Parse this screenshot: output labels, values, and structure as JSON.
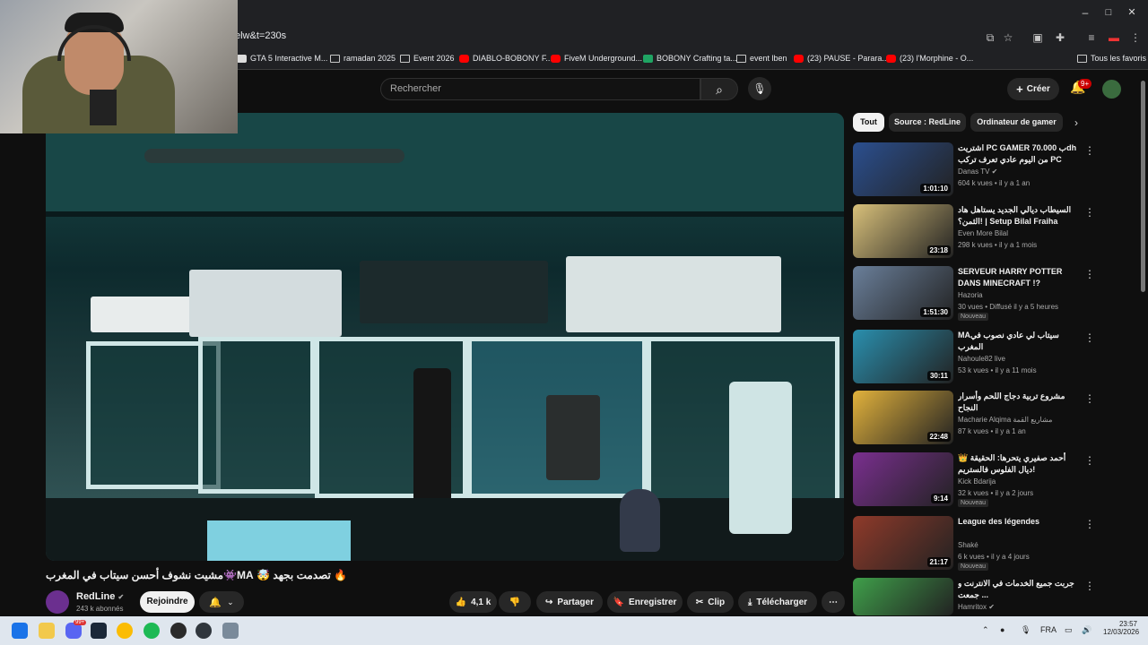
{
  "browser": {
    "address": "elw&t=230s",
    "window_controls": [
      "–",
      "□",
      "✕"
    ],
    "bookmarks": [
      {
        "label": "GTA 5 Interactive M...",
        "icon": "white"
      },
      {
        "label": "ramadan 2025",
        "icon": "folder"
      },
      {
        "label": "Event 2026",
        "icon": "folder"
      },
      {
        "label": "DIABLO-BOBONY F...",
        "icon": "yt"
      },
      {
        "label": "FiveM Underground...",
        "icon": "yt"
      },
      {
        "label": "BOBONY Crafting ta...",
        "icon": "green"
      },
      {
        "label": "event lben",
        "icon": "folder"
      },
      {
        "label": "(23) PAUSE - Parara...",
        "icon": "yt"
      },
      {
        "label": "(23) l'Morphine - O...",
        "icon": "yt"
      }
    ],
    "all_bookmarks": "Tous les favoris"
  },
  "masthead": {
    "search_placeholder": "Rechercher",
    "create_label": "Créer",
    "notif_count": "9+"
  },
  "video": {
    "title": "🔥 تصدمت بجهد 🤯 MA👾مشيت نشوف أحسن سيتاب في المغرب",
    "channel_name": "RedLine",
    "subscribers": "243 k abonnés",
    "join_label": "Rejoindre",
    "likes": "4,1 k",
    "share_label": "Partager",
    "save_label": "Enregistrer",
    "clip_label": "Clip",
    "download_label": "Télécharger"
  },
  "chips": [
    "Tout",
    "Source : RedLine",
    "Ordinateur de gamer"
  ],
  "related": [
    {
      "title": "اشتريت PC GAMER ب 70.000dh من اليوم عادي تعرف تركب PC بوحدك...",
      "channel": "Danas TV",
      "verified": true,
      "meta": "604 k vues • il y a 1 an",
      "duration": "1:01:10",
      "badge": "",
      "thumb_color": "#2b4f8f"
    },
    {
      "title": "السيطاب ديالي الجديد يستاهل هاد الثمن؟! | Setup Bilal Fraiha",
      "channel": "Even More Bilal",
      "verified": false,
      "meta": "298 k vues • il y a 1 mois",
      "duration": "23:18",
      "badge": "",
      "thumb_color": "#d8c07a"
    },
    {
      "title": "SERVEUR HARRY POTTER DANS MINECRAFT !?",
      "channel": "Hazoria",
      "verified": false,
      "meta": "30 vues • Diffusé il y a 5 heures",
      "duration": "1:51:30",
      "badge": "Nouveau",
      "thumb_color": "#6a7f9a"
    },
    {
      "title": "MAسيتاب لي عادي نصوب في المغرب",
      "channel": "Nahoule82 live",
      "verified": false,
      "meta": "53 k vues • il y a 11 mois",
      "duration": "30:11",
      "badge": "",
      "thumb_color": "#2a8fae"
    },
    {
      "title": "مشروع تربية دجاج اللحم وأسرار النجاح",
      "channel": "Macharie Alqima مشاريع القمة",
      "verified": false,
      "meta": "87 k vues • il y a 1 an",
      "duration": "22:48",
      "badge": "",
      "thumb_color": "#e2b23c"
    },
    {
      "title": "👑 أحمد صفيري يتحرها: الحقيقة ديال الفلوس فالستريم!",
      "channel": "Kick Bdarija",
      "verified": false,
      "meta": "32 k vues • il y a 2 jours",
      "duration": "9:14",
      "badge": "Nouveau",
      "thumb_color": "#7a2f8f"
    },
    {
      "title": "League des légendes",
      "channel": "Shaké",
      "verified": false,
      "meta": "6 k vues • il y a 4 jours",
      "duration": "21:17",
      "badge": "Nouveau",
      "thumb_color": "#8f3a2a"
    },
    {
      "title": "جربت جميع الخدمات في الانترنت و جمعت ...",
      "channel": "Hamritox",
      "verified": true,
      "meta": "",
      "duration": "",
      "badge": "",
      "thumb_color": "#3f9f4a"
    }
  ],
  "taskbar": {
    "language": "FRA",
    "time": "23:57",
    "date": "12/03/2026",
    "discord_badge": "99+"
  }
}
